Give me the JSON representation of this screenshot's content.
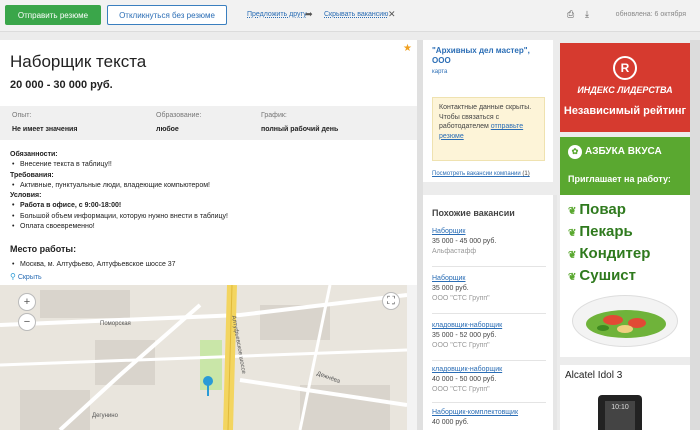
{
  "topbar": {
    "apply_label": "Отправить резюме",
    "apply_without_label": "Откликнуться без резюме",
    "recommend_label": "Предложить другу",
    "hide_vacancy_label": "Скрывать вакансию",
    "updated": "обновлена: 6 октября"
  },
  "vacancy": {
    "title": "Наборщик текста",
    "salary": "20 000 - 30 000 руб.",
    "info": [
      {
        "label": "Опыт:",
        "value": "Не имеет значения"
      },
      {
        "label": "Образование:",
        "value": "любое"
      },
      {
        "label": "График:",
        "value": "полный рабочий день"
      }
    ],
    "duties_title": "Обязанности:",
    "duties": [
      "Внесение текста в таблицу!!"
    ],
    "requirements_title": "Требования:",
    "requirements": [
      "Активные, пунктуальные люди, владеющие компьютером!"
    ],
    "conditions_title": "Условия:",
    "conditions": [
      "Работа в офисе, с 9:00-18:00!",
      "Большой объем информации, которую нужно внести в таблицу!",
      "Оплата своевременно!"
    ],
    "place_title": "Место работы:",
    "address": "Москва, м. Алтуфьево, Алтуфьевское шоссе 37",
    "hide_map": "Скрыть"
  },
  "map": {
    "labels": [
      "Поморская",
      "Алтуфьевское шоссе",
      "Дежнёва",
      "Дегунино"
    ]
  },
  "company": {
    "name": "\"Архивных дел мастер\", ООО",
    "map_link": "карта",
    "contact_text": "Контактные данные скрыты. Чтобы связаться с работодателем",
    "contact_link": "отправьте резюме",
    "all_vacancies": "Посмотреть вакансии компании",
    "all_vacancies_count": "(1)"
  },
  "similar": {
    "title": "Похожие вакансии",
    "items": [
      {
        "title": "Наборщик",
        "salary": "35 000 - 45 000 руб.",
        "company": "Альфастафф"
      },
      {
        "title": "Наборщик",
        "salary": "35 000 руб.",
        "company": "ООО \"СТС Групп\""
      },
      {
        "title": "кладовщик-наборщик",
        "salary": "35 000 - 52 000 руб.",
        "company": "ООО \"СТС Групп\""
      },
      {
        "title": "кладовщик-наборщик",
        "salary": "40 000 - 50 000 руб.",
        "company": "ООО \"СТС Групп\""
      },
      {
        "title": "Наборщик-комплектовщик",
        "salary": "40 000 руб.",
        "company": ""
      }
    ]
  },
  "ads": {
    "ad1_line1": "ИНДЕКС ЛИДЕРСТВА",
    "ad1_line2": "Независимый рейтинг",
    "ad2_brand": "АЗБУКА ВКУСА",
    "ad2_invite": "Приглашает на работу:",
    "ad2_jobs": [
      "Повар",
      "Пекарь",
      "Кондитер",
      "Сушист"
    ],
    "ad3_name": "Alcatel Idol 3",
    "ad3_screen": "10:10"
  },
  "colors": {
    "green": "#3aa64a",
    "link": "#2a6db5",
    "star": "#f0a020"
  }
}
